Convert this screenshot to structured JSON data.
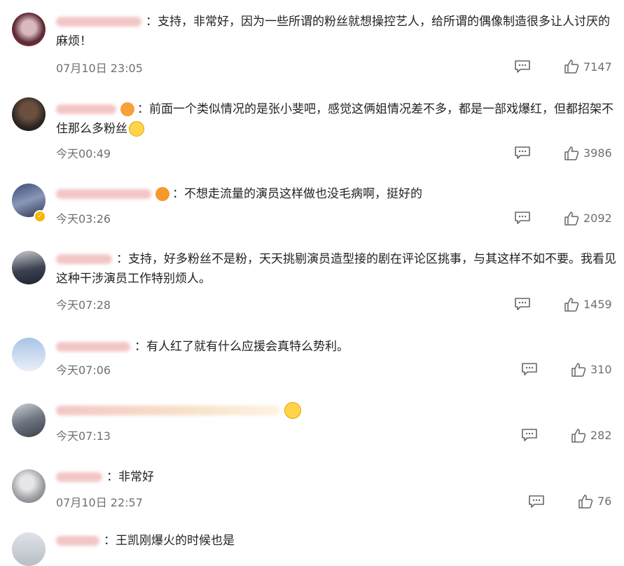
{
  "comments": [
    {
      "text": "：支持，非常好，因为一些所谓的粉丝就想操控艺人，给所谓的偶像制造很多让人讨厌的麻烦！",
      "time": "07月10日 23:05",
      "likes": "7147"
    },
    {
      "text": "：前面一个类似情况的是张小斐吧，感觉这俩姐情况差不多，都是一部戏爆红，但都招架不住那么多粉丝",
      "time": "今天00:49",
      "likes": "3986"
    },
    {
      "text": "：不想走流量的演员这样做也没毛病啊，挺好的",
      "time": "今天03:26",
      "likes": "2092"
    },
    {
      "text": "：支持，好多粉丝不是粉，天天挑剔演员造型接的剧在评论区挑事，与其这样不如不要。我看见这种干涉演员工作特别烦人。",
      "time": "今天07:28",
      "likes": "1459"
    },
    {
      "text": "：有人红了就有什么应援会真特么势利。",
      "time": "今天07:06",
      "likes": "310"
    },
    {
      "text": "",
      "time": "今天07:13",
      "likes": "282"
    },
    {
      "text": "：非常好",
      "time": "07月10日 22:57",
      "likes": "76"
    },
    {
      "text": "：王凯刚爆火的时候也是",
      "time": "",
      "likes": ""
    }
  ],
  "icons": {
    "reply": "comment-bubble-icon",
    "like": "thumbs-up-icon"
  },
  "colors": {
    "meta": "#6f6f6f",
    "text": "#222222"
  }
}
